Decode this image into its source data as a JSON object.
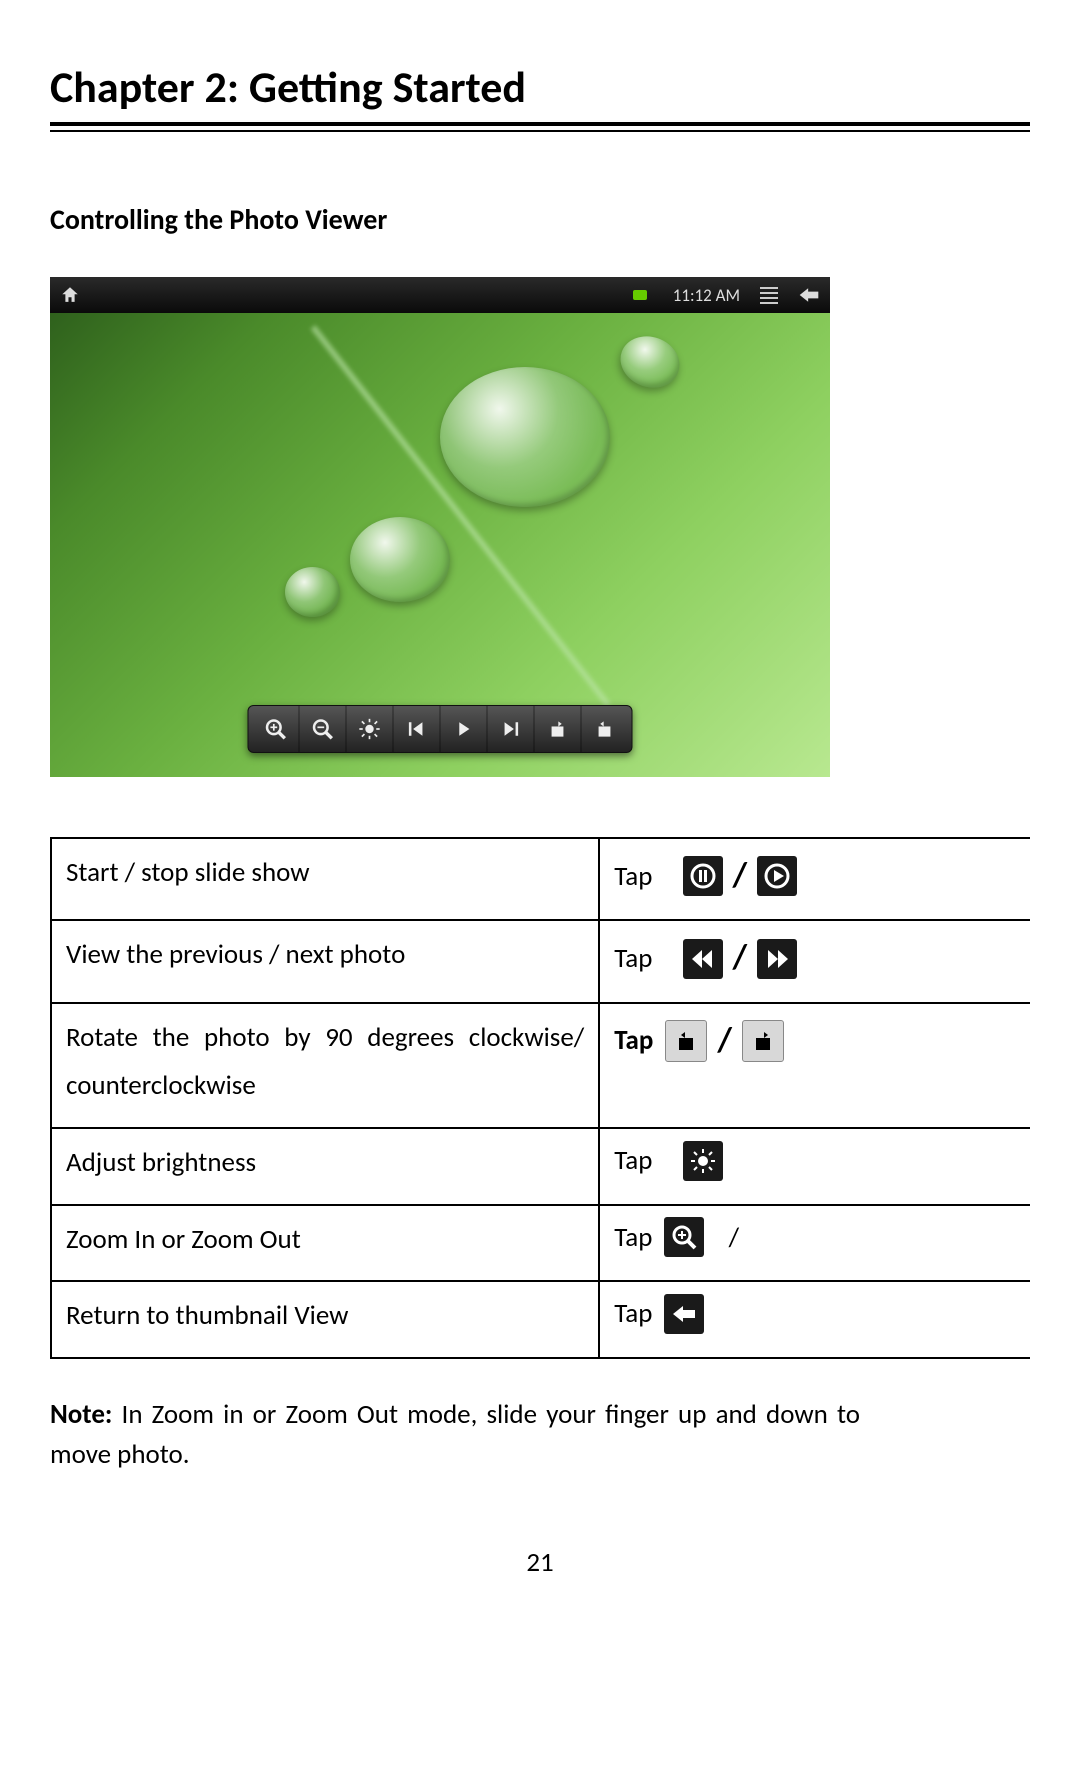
{
  "chapter_title": "Chapter 2: Getting Started",
  "section_title": "Controlling the Photo Viewer",
  "screenshot": {
    "statusbar_time": "11:12 AM",
    "toolbar_icons": [
      "zoom-in",
      "zoom-out",
      "brightness",
      "previous",
      "play",
      "next",
      "rotate-ccw",
      "rotate-cw"
    ]
  },
  "controls": [
    {
      "description": "Start / stop slide show",
      "action_prefix": "Tap",
      "icons": [
        "pause",
        "play"
      ],
      "bold_prefix": false
    },
    {
      "description": "View the previous / next photo",
      "action_prefix": "Tap",
      "icons": [
        "prev",
        "next"
      ],
      "bold_prefix": false
    },
    {
      "description": "Rotate the photo by 90 degrees clockwise/ counterclockwise",
      "action_prefix": "Tap",
      "icons": [
        "rotate-cw",
        "rotate-ccw"
      ],
      "bold_prefix": true,
      "light_chips": true
    },
    {
      "description": "Adjust brightness",
      "action_prefix": "Tap",
      "icons": [
        "brightness"
      ],
      "bold_prefix": false
    },
    {
      "description": "Zoom In or Zoom Out",
      "action_prefix": "Tap",
      "icons": [
        "zoom-in"
      ],
      "trailing_slash": true,
      "bold_prefix": false
    },
    {
      "description": "Return to thumbnail View",
      "action_prefix": "Tap",
      "icons": [
        "back"
      ],
      "bold_prefix": false
    }
  ],
  "note_label": "Note:",
  "note_text": " In Zoom in or Zoom Out mode, slide your finger up and down to move photo.",
  "page_number": "21"
}
